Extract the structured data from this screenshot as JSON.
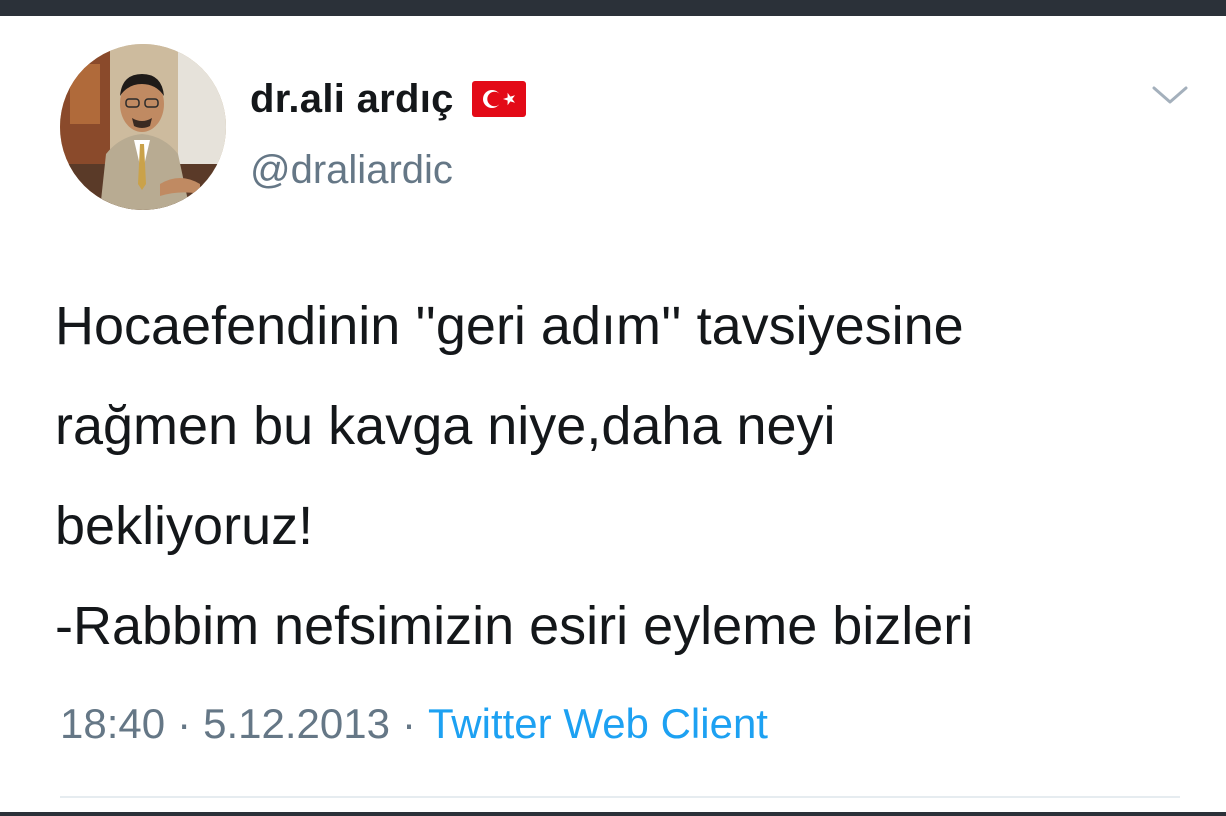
{
  "tweet": {
    "author": {
      "display_name": "dr.ali ardıç",
      "handle": "@draliardic",
      "flag_icon": "turkey-flag-icon"
    },
    "text_lines": [
      "Hocaefendinin ''geri adım'' tavsiyesine",
      "rağmen bu kavga niye,daha neyi",
      "bekliyoruz!",
      "-Rabbim nefsimizin esiri eyleme bizleri"
    ],
    "meta": {
      "time": "18:40",
      "separator": "·",
      "date": "5.12.2013",
      "source": "Twitter Web Client"
    },
    "menu_icon": "chevron-down-icon"
  },
  "colors": {
    "text": "#14171a",
    "secondary": "#657786",
    "link": "#1da1f2",
    "flag_red": "#e30a17"
  }
}
